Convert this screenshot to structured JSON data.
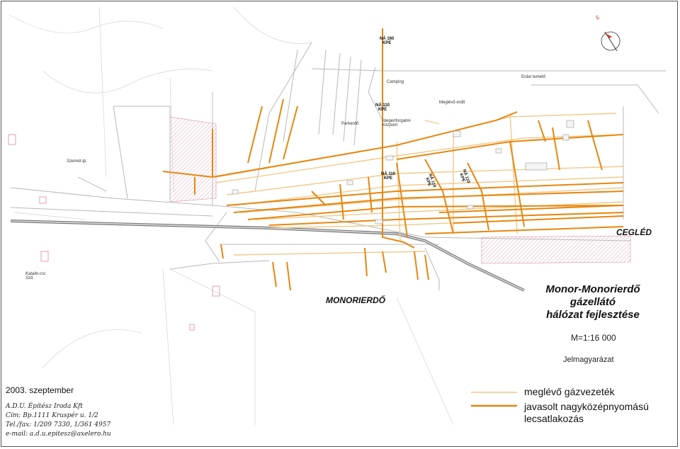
{
  "map": {
    "north_label": "É",
    "colors": {
      "existing_pipe": "#f2c98a",
      "proposed_pipe": "#e8860f",
      "road": "#b9b9b9",
      "railway": "#7a7a7a",
      "hatch": "#d98aa0"
    },
    "place_labels": {
      "nevele": "NÁ 160\nKPE",
      "camping": "Camping",
      "erdei_temeto": "Erdei temető",
      "meglevo_erdo": "Meglévő erdő",
      "parkerdo": "Parkerdő",
      "na110_top": "NÁ 110\nKPE",
      "idegenforgalmi": "Idegenforgalmi\nközpont",
      "szemet_tp": "Szemét-tp.",
      "na110_mid": "NÁ 110\nKPE",
      "na110_rot1": "NÁ 110\nKPE",
      "na110_rot2": "NÁ 110\nKPE",
      "katalin": "Katalin-csr.\nSző.",
      "cegled": "CEGLÉD",
      "monorierdo": "MONORIERDŐ"
    }
  },
  "title": {
    "line1": "Monor-Monorierdő",
    "line2": "gázellátó",
    "line3": "hálózat fejlesztése",
    "scale": "M=1:16 000"
  },
  "legend": {
    "heading": "Jelmagyarázat",
    "items": [
      {
        "label": "meglévő gázvezeték",
        "color": "#f2c98a"
      },
      {
        "label": "javasolt nagyközépnyomású\nlecsatlakozás",
        "color": "#e8860f"
      }
    ]
  },
  "footer": {
    "date": "2003. szeptember",
    "office_lines": [
      "A.D.U. Építész Iroda Kft",
      "Cím: Bp.1111 Kruspér u. 1/2",
      "Tel./fax: 1/209 7330, 1/361 4957",
      "e-mail: a.d.u.epitesz@axelero.hu"
    ]
  }
}
